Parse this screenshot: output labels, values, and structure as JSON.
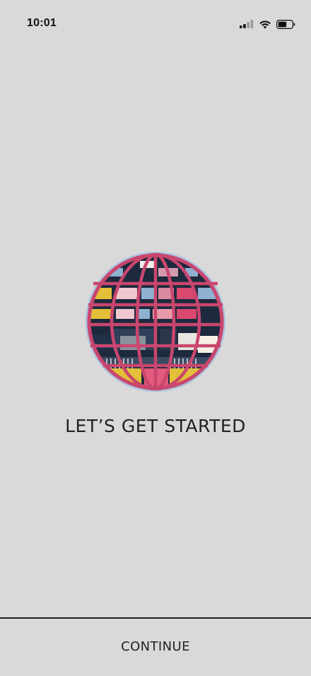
{
  "status_bar": {
    "time": "10:01",
    "icons": [
      "cellular-signal-icon",
      "wifi-icon",
      "battery-icon"
    ]
  },
  "hero": {
    "image": "globe-illustration",
    "title": "LET’S GET STARTED"
  },
  "footer": {
    "continue_label": "CONTINUE"
  },
  "colors": {
    "background": "#d9d9d9",
    "text": "#222222",
    "globe_outline": "#c9466e",
    "globe_dark": "#1d2a3d",
    "globe_accent_yellow": "#e3bf3a",
    "globe_accent_blue": "#8fb1d2"
  }
}
